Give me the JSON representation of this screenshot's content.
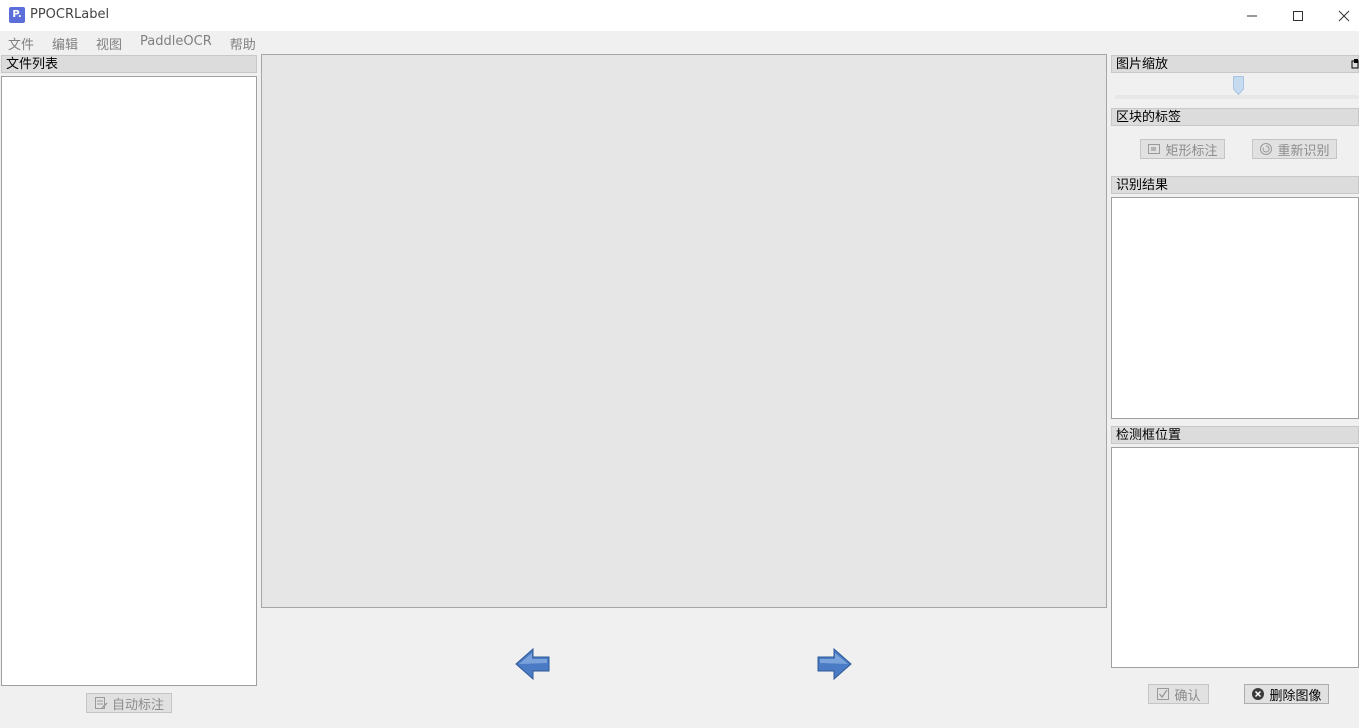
{
  "window": {
    "app_icon_letter": "P.",
    "title": "PPOCRLabel"
  },
  "menu": [
    "文件",
    "编辑",
    "视图",
    "PaddleOCR",
    "帮助"
  ],
  "left_dock": {
    "title": "文件列表",
    "auto_label_button": "自动标注"
  },
  "right_dock": {
    "zoom_title": "图片缩放",
    "zoom_level": 0.5,
    "box_label_title": "区块的标签",
    "rect_label_button": "矩形标注",
    "re_recognize_button": "重新识别",
    "recognition_result_title": "识别结果",
    "detection_box_title": "检测框位置",
    "confirm_button": "确认",
    "delete_image_button": "删除图像"
  },
  "navigation": {
    "prev_icon": "left-arrow-icon",
    "next_icon": "right-arrow-icon"
  },
  "colors": {
    "arrow_blue": "#3f6fb6",
    "canvas_bg": "#e6e6e6",
    "disabled_text": "#8c8c8c"
  }
}
